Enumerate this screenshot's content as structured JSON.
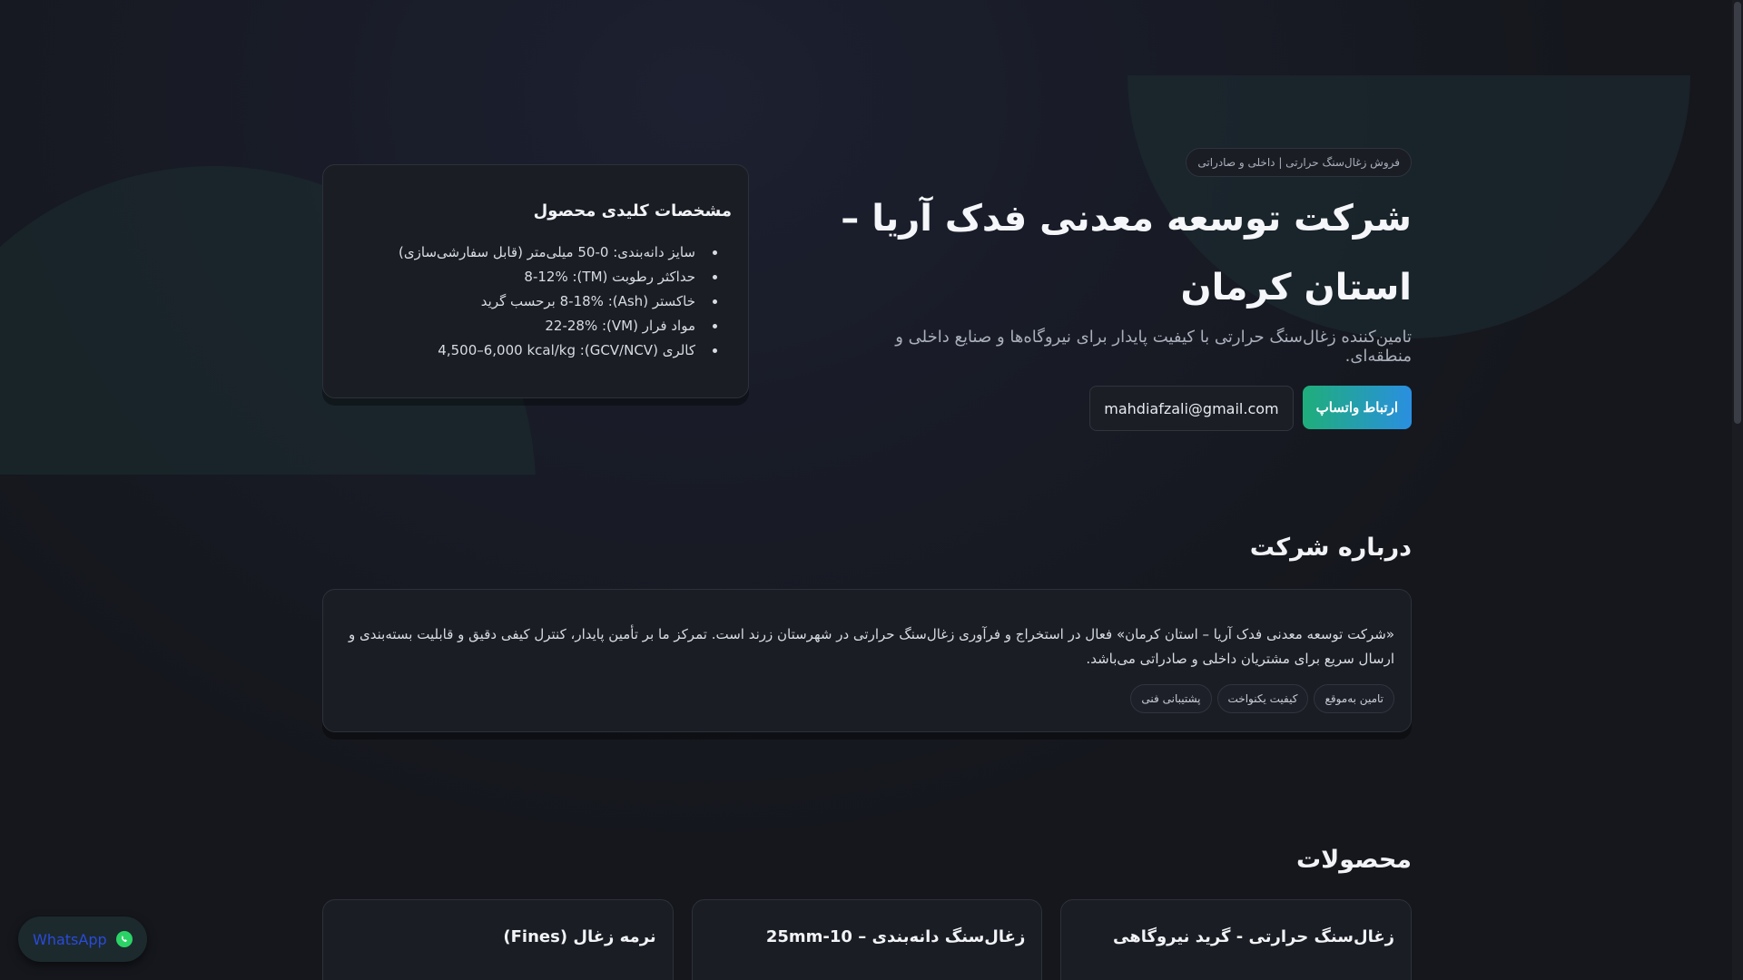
{
  "hero": {
    "tag": "فروش زغال‌سنگ حرارتی | داخلی و صادراتی",
    "title": "شرکت توسعه معدنی فدک آریا – استان کرمان",
    "subtitle": "تامین‌کننده زغال‌سنگ حرارتی با کیفیت پایدار برای نیروگاه‌ها و صنایع داخلی و منطقه‌ای.",
    "primary_button": "ارتباط واتساپ",
    "email_button": "mahdiafzali@gmail.com"
  },
  "specs": {
    "title": "مشخصات کلیدی محصول",
    "items": [
      "سایز دانه‌بندی: 0-50 میلی‌متر (قابل سفارشی‌سازی)",
      "حداکثر رطوبت (TM): 8-12%",
      "خاکستر (Ash): 8-18% برحسب گرید",
      "مواد فرار (VM): 22-28%",
      "کالری (GCV/NCV): 4,500–6,000 kcal/kg"
    ]
  },
  "about": {
    "title": "درباره شرکت",
    "text": "«شرکت توسعه معدنی فدک آریا – استان کرمان» فعال در استخراج و فرآوری زغال‌سنگ حرارتی در شهرستان زرند است. تمرکز ما بر تأمین پایدار، کنترل کیفی دقیق و قابلیت بسته‌بندی و ارسال سریع برای مشتریان داخلی و صادراتی می‌باشد.",
    "pills": [
      "تامین به‌موقع",
      "کیفیت یکنواخت",
      "پشتیبانی فنی"
    ]
  },
  "products": {
    "title": "محصولات",
    "items": [
      "زغال‌سنگ حرارتی - گرید نیروگاهی",
      "زغال‌سنگ دانه‌بندی – 10-25mm",
      "نرمه زغال (Fines)"
    ]
  },
  "whatsapp_float": {
    "label": "WhatsApp",
    "icon": "whatsapp-icon"
  },
  "colors": {
    "background": "#15171d",
    "card": "#1a1d24",
    "accent_start": "#1fae7a",
    "accent_end": "#2a8fe0"
  }
}
